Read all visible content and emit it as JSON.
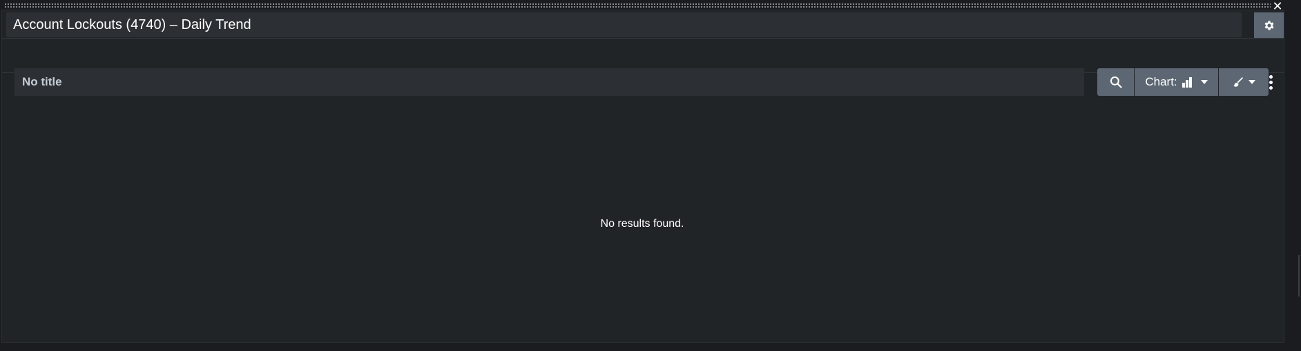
{
  "panel": {
    "title": "Account Lockouts (4740) – Daily Trend",
    "close_glyph": "✕",
    "gear_icon": "gear-icon"
  },
  "visualization": {
    "title_placeholder": "No title",
    "empty_message": "No results found.",
    "toolbar": {
      "search_icon": "search-icon",
      "chart_label": "Chart:",
      "chart_icon": "bar-chart-icon",
      "format_icon": "paintbrush-icon",
      "more_icon": "vertical-ellipsis-icon"
    }
  },
  "colors": {
    "background": "#212427",
    "input_background": "#2c3035",
    "button_background": "#5c6773",
    "text": "#ffffff"
  }
}
